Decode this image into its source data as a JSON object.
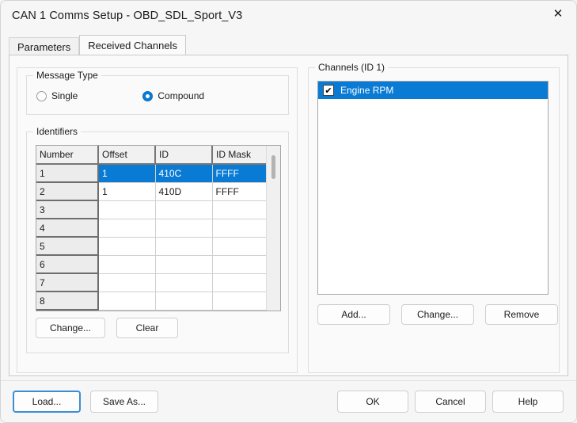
{
  "window": {
    "title": "CAN 1 Comms Setup - OBD_SDL_Sport_V3",
    "close_icon": "close-icon",
    "close_glyph": "✕"
  },
  "accent_color": "#0a7bd4",
  "tabs": [
    {
      "label": "Parameters",
      "active": false
    },
    {
      "label": "Received Channels",
      "active": true
    }
  ],
  "message_type": {
    "group_label": "Message Type",
    "options": [
      {
        "label": "Single",
        "selected": false
      },
      {
        "label": "Compound",
        "selected": true
      }
    ]
  },
  "identifiers": {
    "group_label": "Identifiers",
    "columns": [
      "Number",
      "Offset",
      "ID",
      "ID Mask"
    ],
    "rows": [
      {
        "number": "1",
        "offset": "1",
        "id": "410C",
        "id_mask": "FFFF",
        "selected": true
      },
      {
        "number": "2",
        "offset": "1",
        "id": "410D",
        "id_mask": "FFFF",
        "selected": false
      },
      {
        "number": "3",
        "offset": "",
        "id": "",
        "id_mask": "",
        "selected": false
      },
      {
        "number": "4",
        "offset": "",
        "id": "",
        "id_mask": "",
        "selected": false
      },
      {
        "number": "5",
        "offset": "",
        "id": "",
        "id_mask": "",
        "selected": false
      },
      {
        "number": "6",
        "offset": "",
        "id": "",
        "id_mask": "",
        "selected": false
      },
      {
        "number": "7",
        "offset": "",
        "id": "",
        "id_mask": "",
        "selected": false
      },
      {
        "number": "8",
        "offset": "",
        "id": "",
        "id_mask": "",
        "selected": false
      }
    ],
    "change_label": "Change...",
    "clear_label": "Clear"
  },
  "channels": {
    "group_label": "Channels (ID 1)",
    "items": [
      {
        "label": "Engine RPM",
        "checked": true,
        "selected": true,
        "check_glyph": "✔"
      }
    ],
    "add_label": "Add...",
    "change_label": "Change...",
    "remove_label": "Remove"
  },
  "footer": {
    "load_label": "Load...",
    "save_as_label": "Save As...",
    "ok_label": "OK",
    "cancel_label": "Cancel",
    "help_label": "Help"
  }
}
